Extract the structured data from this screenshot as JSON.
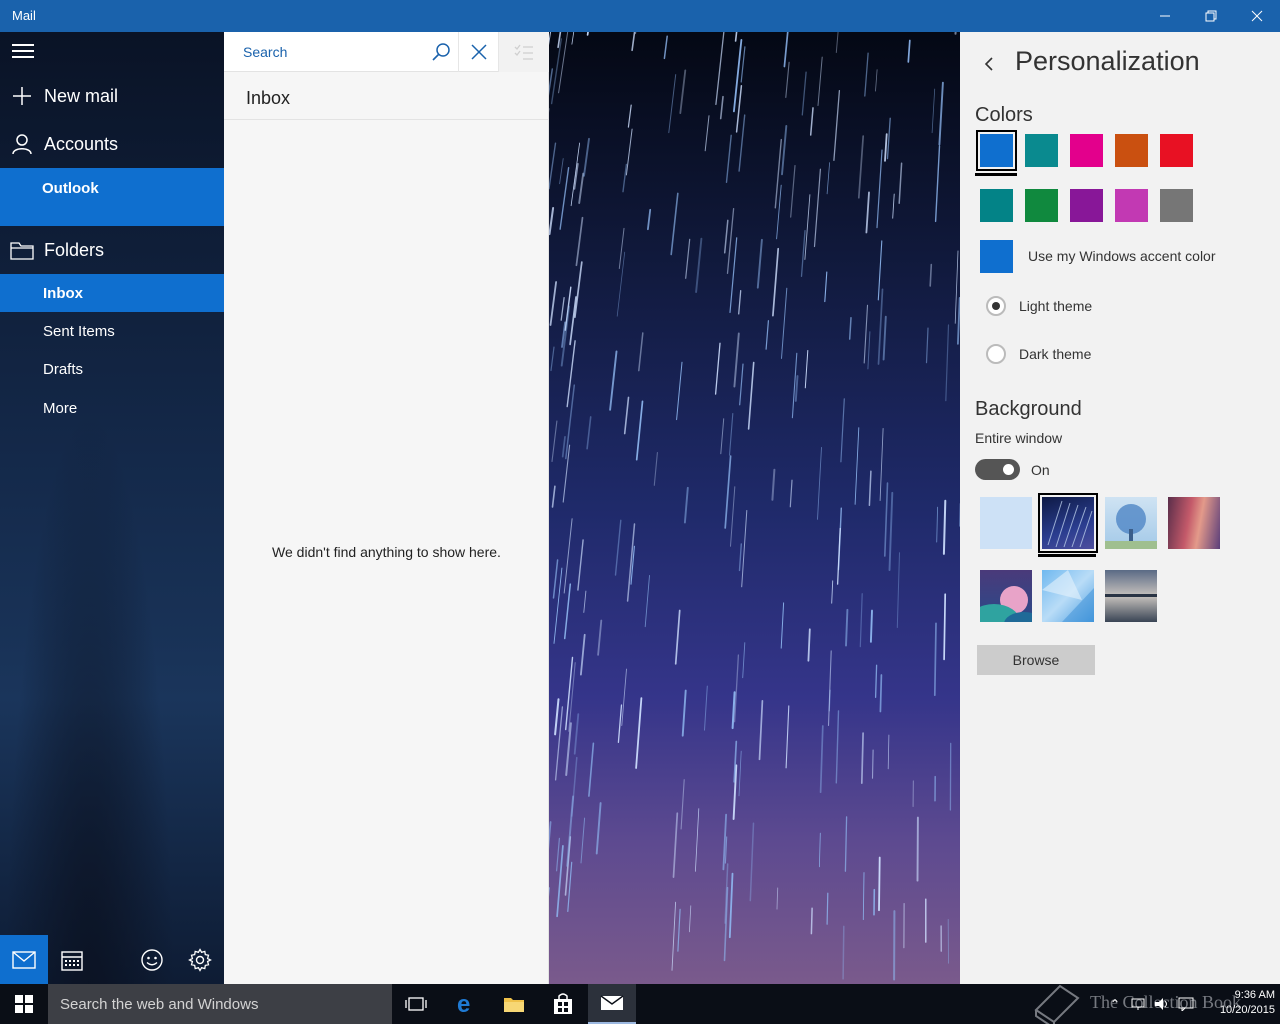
{
  "window": {
    "title": "Mail",
    "controls": [
      "minimize",
      "restore",
      "close"
    ]
  },
  "nav": {
    "new_mail": "New mail",
    "accounts": "Accounts",
    "account_name": "Outlook",
    "folders_heading": "Folders",
    "folders": [
      {
        "label": "Inbox",
        "active": true
      },
      {
        "label": "Sent Items",
        "active": false
      },
      {
        "label": "Drafts",
        "active": false
      },
      {
        "label": "More",
        "active": false
      }
    ],
    "bottom_icons": [
      "mail-icon",
      "calendar-icon",
      "smiley-icon",
      "gear-icon"
    ]
  },
  "list": {
    "search_placeholder": "Search",
    "folder_title": "Inbox",
    "empty_message": "We didn't find anything to show here."
  },
  "settings": {
    "title": "Personalization",
    "colors_heading": "Colors",
    "color_swatches": [
      "#0f6fcf",
      "#0a8a8f",
      "#e3008c",
      "#ca5010",
      "#e81123",
      "#038387",
      "#10893e",
      "#881798",
      "#c239b3",
      "#767676"
    ],
    "selected_color": "#0f6fcf",
    "accent_label": "Use my Windows accent color",
    "accent_color": "#0f6fcf",
    "theme_options": [
      {
        "label": "Light theme",
        "selected": true
      },
      {
        "label": "Dark theme",
        "selected": false
      }
    ],
    "background_heading": "Background",
    "entire_window_label": "Entire window",
    "toggle_state": "On",
    "browse_label": "Browse"
  },
  "taskbar": {
    "search_placeholder": "Search the web and Windows",
    "time": "9:36 AM",
    "date": "10/20/2015",
    "watermark": "The Collection Book",
    "pinned_icons": [
      "task-view-icon",
      "edge-icon",
      "file-explorer-icon",
      "store-icon",
      "mail-icon"
    ]
  },
  "colors": {
    "title_bar": "#1a62ac",
    "accent": "#0f6fcf",
    "taskbar": "#0a0e16"
  }
}
